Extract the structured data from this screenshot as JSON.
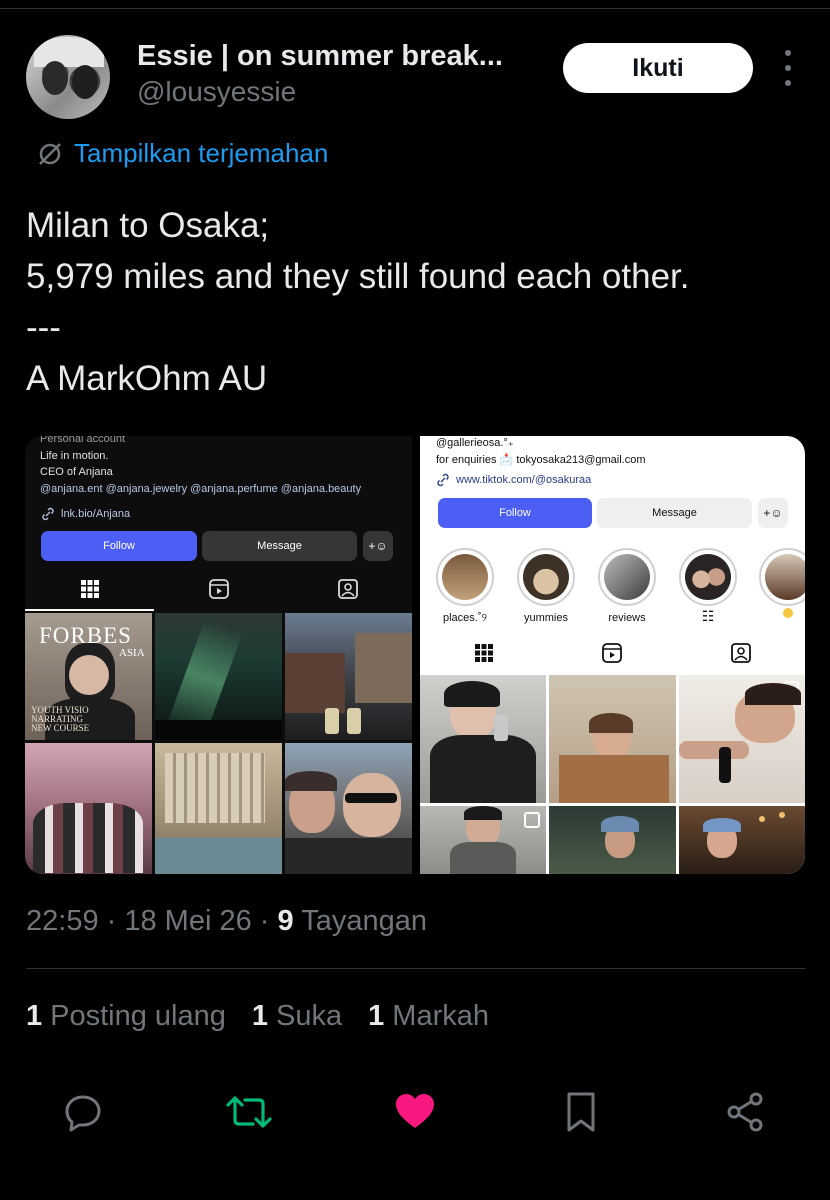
{
  "author": {
    "display_name": "Essie | on summer break...",
    "handle": "@lousyessie"
  },
  "follow_label": "Ikuti",
  "translate_label": "Tampilkan terjemahan",
  "tweet_lines": [
    "Milan to Osaka;",
    "5,979 miles and they still found each other.",
    "---",
    "A MarkOhm AU"
  ],
  "media": {
    "left": {
      "account_type": "Personal account",
      "bio_line1": "Life in motion.",
      "bio_line2": "CEO of Anjana",
      "bio_mentions": "@anjana.ent @anjana.jewelry @anjana.perfume @anjana.beauty",
      "link": "lnk.bio/Anjana",
      "follow": "Follow",
      "message": "Message",
      "magazine_title": "FORBES",
      "magazine_sub": "ASIA",
      "magazine_line1": "YOUTH VISIO",
      "magazine_line2": "NARRATING",
      "magazine_line3": "NEW COURSE"
    },
    "right": {
      "username": "@gallerieosa.°₊",
      "enquiries": "for enquiries 📩 tokyosaka213@gmail.com",
      "link": "www.tiktok.com/@osakuraa",
      "follow": "Follow",
      "message": "Message",
      "highlights": [
        "places.˚୨",
        "yummies",
        "reviews",
        "☷",
        ""
      ]
    }
  },
  "meta": {
    "time": "22:59",
    "date": "18 Mei 26",
    "views_count": "9",
    "views_label": "Tayangan"
  },
  "stats": {
    "reposts_count": "1",
    "reposts_label": "Posting ulang",
    "likes_count": "1",
    "likes_label": "Suka",
    "bookmarks_count": "1",
    "bookmarks_label": "Markah"
  },
  "colors": {
    "link_blue": "#1d9bf0",
    "repost_green": "#00ba7c",
    "like_pink": "#f91880",
    "muted": "#71767b",
    "ig_blue": "#4c5ef4"
  }
}
